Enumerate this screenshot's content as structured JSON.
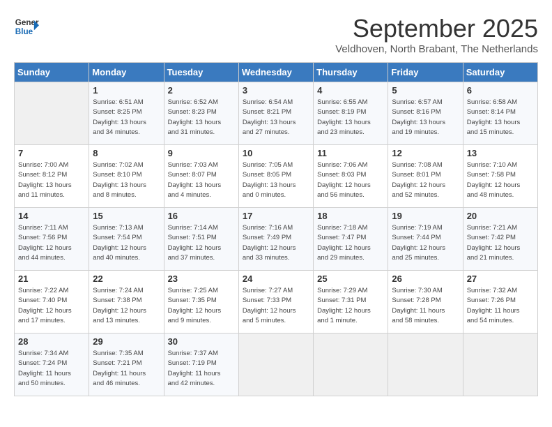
{
  "header": {
    "logo_general": "General",
    "logo_blue": "Blue",
    "month": "September 2025",
    "location": "Veldhoven, North Brabant, The Netherlands"
  },
  "columns": [
    "Sunday",
    "Monday",
    "Tuesday",
    "Wednesday",
    "Thursday",
    "Friday",
    "Saturday"
  ],
  "weeks": [
    [
      {
        "day": "",
        "info": ""
      },
      {
        "day": "1",
        "info": "Sunrise: 6:51 AM\nSunset: 8:25 PM\nDaylight: 13 hours\nand 34 minutes."
      },
      {
        "day": "2",
        "info": "Sunrise: 6:52 AM\nSunset: 8:23 PM\nDaylight: 13 hours\nand 31 minutes."
      },
      {
        "day": "3",
        "info": "Sunrise: 6:54 AM\nSunset: 8:21 PM\nDaylight: 13 hours\nand 27 minutes."
      },
      {
        "day": "4",
        "info": "Sunrise: 6:55 AM\nSunset: 8:19 PM\nDaylight: 13 hours\nand 23 minutes."
      },
      {
        "day": "5",
        "info": "Sunrise: 6:57 AM\nSunset: 8:16 PM\nDaylight: 13 hours\nand 19 minutes."
      },
      {
        "day": "6",
        "info": "Sunrise: 6:58 AM\nSunset: 8:14 PM\nDaylight: 13 hours\nand 15 minutes."
      }
    ],
    [
      {
        "day": "7",
        "info": "Sunrise: 7:00 AM\nSunset: 8:12 PM\nDaylight: 13 hours\nand 11 minutes."
      },
      {
        "day": "8",
        "info": "Sunrise: 7:02 AM\nSunset: 8:10 PM\nDaylight: 13 hours\nand 8 minutes."
      },
      {
        "day": "9",
        "info": "Sunrise: 7:03 AM\nSunset: 8:07 PM\nDaylight: 13 hours\nand 4 minutes."
      },
      {
        "day": "10",
        "info": "Sunrise: 7:05 AM\nSunset: 8:05 PM\nDaylight: 13 hours\nand 0 minutes."
      },
      {
        "day": "11",
        "info": "Sunrise: 7:06 AM\nSunset: 8:03 PM\nDaylight: 12 hours\nand 56 minutes."
      },
      {
        "day": "12",
        "info": "Sunrise: 7:08 AM\nSunset: 8:01 PM\nDaylight: 12 hours\nand 52 minutes."
      },
      {
        "day": "13",
        "info": "Sunrise: 7:10 AM\nSunset: 7:58 PM\nDaylight: 12 hours\nand 48 minutes."
      }
    ],
    [
      {
        "day": "14",
        "info": "Sunrise: 7:11 AM\nSunset: 7:56 PM\nDaylight: 12 hours\nand 44 minutes."
      },
      {
        "day": "15",
        "info": "Sunrise: 7:13 AM\nSunset: 7:54 PM\nDaylight: 12 hours\nand 40 minutes."
      },
      {
        "day": "16",
        "info": "Sunrise: 7:14 AM\nSunset: 7:51 PM\nDaylight: 12 hours\nand 37 minutes."
      },
      {
        "day": "17",
        "info": "Sunrise: 7:16 AM\nSunset: 7:49 PM\nDaylight: 12 hours\nand 33 minutes."
      },
      {
        "day": "18",
        "info": "Sunrise: 7:18 AM\nSunset: 7:47 PM\nDaylight: 12 hours\nand 29 minutes."
      },
      {
        "day": "19",
        "info": "Sunrise: 7:19 AM\nSunset: 7:44 PM\nDaylight: 12 hours\nand 25 minutes."
      },
      {
        "day": "20",
        "info": "Sunrise: 7:21 AM\nSunset: 7:42 PM\nDaylight: 12 hours\nand 21 minutes."
      }
    ],
    [
      {
        "day": "21",
        "info": "Sunrise: 7:22 AM\nSunset: 7:40 PM\nDaylight: 12 hours\nand 17 minutes."
      },
      {
        "day": "22",
        "info": "Sunrise: 7:24 AM\nSunset: 7:38 PM\nDaylight: 12 hours\nand 13 minutes."
      },
      {
        "day": "23",
        "info": "Sunrise: 7:25 AM\nSunset: 7:35 PM\nDaylight: 12 hours\nand 9 minutes."
      },
      {
        "day": "24",
        "info": "Sunrise: 7:27 AM\nSunset: 7:33 PM\nDaylight: 12 hours\nand 5 minutes."
      },
      {
        "day": "25",
        "info": "Sunrise: 7:29 AM\nSunset: 7:31 PM\nDaylight: 12 hours\nand 1 minute."
      },
      {
        "day": "26",
        "info": "Sunrise: 7:30 AM\nSunset: 7:28 PM\nDaylight: 11 hours\nand 58 minutes."
      },
      {
        "day": "27",
        "info": "Sunrise: 7:32 AM\nSunset: 7:26 PM\nDaylight: 11 hours\nand 54 minutes."
      }
    ],
    [
      {
        "day": "28",
        "info": "Sunrise: 7:34 AM\nSunset: 7:24 PM\nDaylight: 11 hours\nand 50 minutes."
      },
      {
        "day": "29",
        "info": "Sunrise: 7:35 AM\nSunset: 7:21 PM\nDaylight: 11 hours\nand 46 minutes."
      },
      {
        "day": "30",
        "info": "Sunrise: 7:37 AM\nSunset: 7:19 PM\nDaylight: 11 hours\nand 42 minutes."
      },
      {
        "day": "",
        "info": ""
      },
      {
        "day": "",
        "info": ""
      },
      {
        "day": "",
        "info": ""
      },
      {
        "day": "",
        "info": ""
      }
    ]
  ]
}
